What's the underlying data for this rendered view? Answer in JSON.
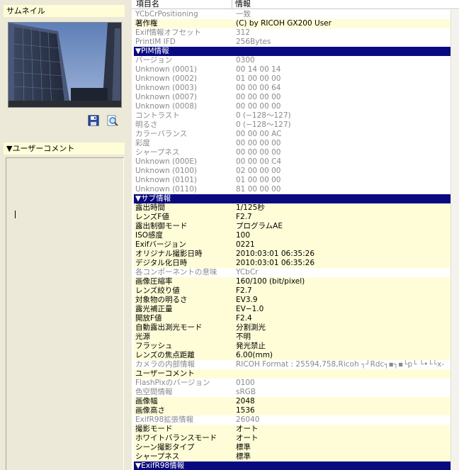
{
  "left_panel": {
    "thumbnail_header": "サムネイル",
    "comment_header": "▼ユーザーコメント"
  },
  "table": {
    "col_name": "項目名",
    "col_info": "情報",
    "rows": [
      {
        "k": "YCbCrPositioning",
        "v": "一致",
        "t": "dim"
      },
      {
        "k": "著作権",
        "v": "(C) by RICOH GX200 User",
        "t": "hl"
      },
      {
        "k": "Exif情報オフセット",
        "v": "312",
        "t": "dim"
      },
      {
        "k": "PrintIM IFD",
        "v": "256Bytes",
        "t": "dim"
      },
      {
        "k": "▼PIM情報",
        "v": "",
        "t": "sec"
      },
      {
        "k": "バージョン",
        "v": "0300",
        "t": "dim"
      },
      {
        "k": "Unknown (0001)",
        "v": "00 14 00 14",
        "t": "dim"
      },
      {
        "k": "Unknown (0002)",
        "v": "01 00 00 00",
        "t": "dim"
      },
      {
        "k": "Unknown (0003)",
        "v": "00 00 00 64",
        "t": "dim"
      },
      {
        "k": "Unknown (0007)",
        "v": "00 00 00 00",
        "t": "dim"
      },
      {
        "k": "Unknown (0008)",
        "v": "00 00 00 00",
        "t": "dim"
      },
      {
        "k": "コントラスト",
        "v": "0 (−128〜127)",
        "t": "dim"
      },
      {
        "k": "明るさ",
        "v": "0 (−128〜127)",
        "t": "dim"
      },
      {
        "k": "カラーバランス",
        "v": "00 00 00 AC",
        "t": "dim"
      },
      {
        "k": "彩度",
        "v": "00 00 00 00",
        "t": "dim"
      },
      {
        "k": "シャープネス",
        "v": "00 00 00 00",
        "t": "dim"
      },
      {
        "k": "Unknown (000E)",
        "v": "00 00 00 C4",
        "t": "dim"
      },
      {
        "k": "Unknown (0100)",
        "v": "02 00 00 00",
        "t": "dim"
      },
      {
        "k": "Unknown (0101)",
        "v": "01 00 00 00",
        "t": "dim"
      },
      {
        "k": "Unknown (0110)",
        "v": "81 00 00 00",
        "t": "dim"
      },
      {
        "k": "▼サブ情報",
        "v": "",
        "t": "sec"
      },
      {
        "k": "露出時間",
        "v": "1/125秒",
        "t": "hl"
      },
      {
        "k": "レンズF値",
        "v": "F2.7",
        "t": "hl"
      },
      {
        "k": "露出制御モード",
        "v": "プログラムAE",
        "t": "hl"
      },
      {
        "k": "ISO感度",
        "v": "100",
        "t": "hl"
      },
      {
        "k": "Exifバージョン",
        "v": "0221",
        "t": "hl"
      },
      {
        "k": "オリジナル撮影日時",
        "v": "2010:03:01 06:35:26",
        "t": "hl"
      },
      {
        "k": "デジタル化日時",
        "v": "2010:03:01 06:35:26",
        "t": "hl"
      },
      {
        "k": "各コンポーネントの意味",
        "v": "YCbCr",
        "t": "dim"
      },
      {
        "k": "画像圧縮率",
        "v": "160/100 (bit/pixel)",
        "t": "hl"
      },
      {
        "k": "レンズ絞り値",
        "v": "F2.7",
        "t": "hl"
      },
      {
        "k": "対象物の明るさ",
        "v": "EV3.9",
        "t": "hl"
      },
      {
        "k": "露光補正量",
        "v": "EV−1.0",
        "t": "hl"
      },
      {
        "k": "開放F値",
        "v": "F2.4",
        "t": "hl"
      },
      {
        "k": "自動露出測光モード",
        "v": "分割測光",
        "t": "hl"
      },
      {
        "k": "光源",
        "v": "不明",
        "t": "hl"
      },
      {
        "k": "フラッシュ",
        "v": "発光禁止",
        "t": "hl"
      },
      {
        "k": "レンズの焦点距離",
        "v": "6.00(mm)",
        "t": "hl"
      },
      {
        "k": "カメラの内部情報",
        "v": "RICOH Format : 25594,758,Ricoh   ┐┘Rdc┐▪┐▪└p└   └•└└x-",
        "t": "dim"
      },
      {
        "k": "ユーザーコメント",
        "v": "",
        "t": "hl"
      },
      {
        "k": "FlashPixのバージョン",
        "v": "0100",
        "t": "dim"
      },
      {
        "k": "色空間情報",
        "v": "sRGB",
        "t": "dim"
      },
      {
        "k": "画像幅",
        "v": "2048",
        "t": "hl"
      },
      {
        "k": "画像高さ",
        "v": "1536",
        "t": "hl"
      },
      {
        "k": "ExifR98拡張情報",
        "v": "26040",
        "t": "dim"
      },
      {
        "k": "撮影モード",
        "v": "オート",
        "t": "hl"
      },
      {
        "k": "ホワイトバランスモード",
        "v": "オート",
        "t": "hl"
      },
      {
        "k": "シーン撮影タイプ",
        "v": "標準",
        "t": "hl"
      },
      {
        "k": "シャープネス",
        "v": "標準",
        "t": "hl"
      },
      {
        "k": "▼ExifR98情報",
        "v": "",
        "t": "sec"
      }
    ]
  }
}
